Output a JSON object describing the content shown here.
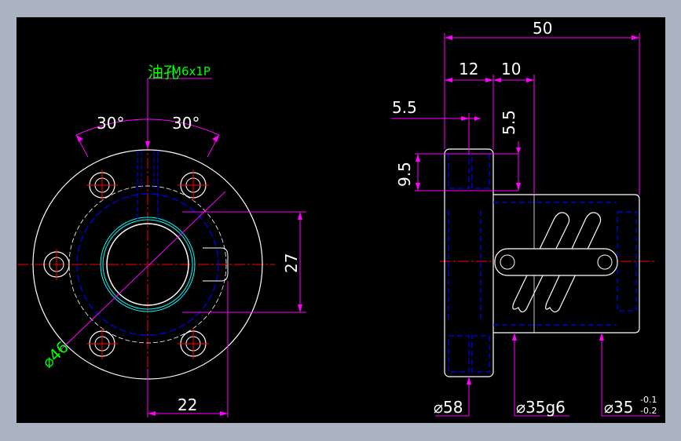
{
  "colors": {
    "background": "#000000",
    "window_border": "#a9b3c2",
    "outline": "#ffffff",
    "dimension": "#ff00ff",
    "hidden": "#0000ff",
    "center": "#ff0000",
    "note": "#00ff00",
    "thread": "#00ffff"
  },
  "front_view": {
    "oil_hole_label": "油孔",
    "oil_hole_thread": "M6x1P",
    "angle_left": "30°",
    "angle_right": "30°",
    "height": "27",
    "diameter": "⌀46",
    "width": "22"
  },
  "side_view": {
    "overall_length": "50",
    "flange_length": "12",
    "offset_length": "10",
    "hole_offset_horizontal": "5.5",
    "hole_offset_vertical": "5.5",
    "hole_spacing": "9.5",
    "flange_diameter": "⌀58",
    "body_diameter": "⌀35g6",
    "end_diameter": "⌀35",
    "tolerance_upper": "-0.1",
    "tolerance_lower": "-0.2"
  }
}
